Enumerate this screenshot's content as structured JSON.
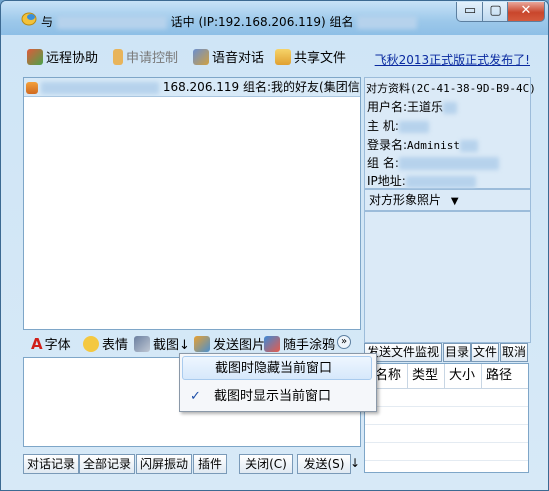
{
  "title": {
    "prefix": "与",
    "suffix": "话中 (IP:192.168.206.119) 组名"
  },
  "window_controls": {
    "minimize": "▭",
    "maximize": "▢",
    "close": "✕"
  },
  "toolbar": {
    "remote_assist": "远程协助",
    "request_control": "申请控制",
    "voice_chat": "语音对话",
    "share_file": "共享文件"
  },
  "announcement": "飞秋2013正式版正式发布了!",
  "chat": {
    "header": "168.206.119 组名:我的好友(集团信"
  },
  "input_toolbar": {
    "font": "字体",
    "emoji": "表情",
    "screenshot": "截图",
    "send_image": "发送图片",
    "doodle": "随手涂鸦",
    "more": "»"
  },
  "bottom_buttons": {
    "history": "对话记录",
    "all_history": "全部记录",
    "shake": "闪屏振动",
    "plugin": "插件",
    "close": "关闭(C)",
    "send": "发送(S)",
    "send_arrow": "↓"
  },
  "peer_info": {
    "header": "对方资料(2C-41-38-9D-B9-4C)",
    "username_label": "用户名:",
    "username_value": "王道乐",
    "host_label": "主  机:",
    "login_label": "登录名:",
    "login_value": "Administ",
    "group_label": "组  名:",
    "ip_label": "IP地址:"
  },
  "photo": {
    "label": "对方形象照片"
  },
  "file_tabs": {
    "monitor": "发送文件监视",
    "directory": "目录",
    "file": "文件",
    "cancel": "取消"
  },
  "file_grid": {
    "columns": [
      "名称",
      "类型",
      "大小",
      "路径"
    ]
  },
  "screenshot_menu": {
    "items": [
      {
        "label": "截图时隐藏当前窗口",
        "checked": false
      },
      {
        "label": "截图时显示当前窗口",
        "checked": true
      }
    ]
  },
  "colors": {
    "link": "#0a2aa0",
    "window_frame": "#3c6a92",
    "close_button": "#c9462c"
  }
}
